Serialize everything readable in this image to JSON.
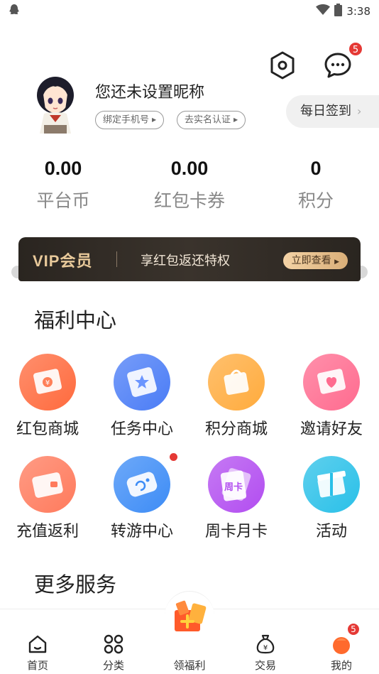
{
  "status_bar": {
    "time": "3:38"
  },
  "header": {
    "message_badge": "5"
  },
  "profile": {
    "nickname": "您还未设置昵称",
    "bind_phone": "绑定手机号",
    "real_name": "去实名认证",
    "checkin": "每日签到"
  },
  "stats": [
    {
      "value": "0.00",
      "label": "平台币"
    },
    {
      "value": "0.00",
      "label": "红包卡券"
    },
    {
      "value": "0",
      "label": "积分"
    }
  ],
  "vip": {
    "title": "VIP会员",
    "desc": "享红包返还特权",
    "button": "立即查看"
  },
  "welfare": {
    "title": "福利中心",
    "items": [
      {
        "label": "红包商城",
        "icon": "red-packet-icon",
        "color": "#ff6a3d"
      },
      {
        "label": "任务中心",
        "icon": "task-star-icon",
        "color": "#4a7cf6"
      },
      {
        "label": "积分商城",
        "icon": "shopping-bag-icon",
        "color": "#ffab3d"
      },
      {
        "label": "邀请好友",
        "icon": "heart-envelope-icon",
        "color": "#ff6b8f"
      },
      {
        "label": "充值返利",
        "icon": "wallet-icon",
        "color": "#ff7a5c"
      },
      {
        "label": "转游中心",
        "icon": "gamepad-icon",
        "color": "#3d8cf6"
      },
      {
        "label": "周卡月卡",
        "icon": "week-card-icon",
        "color": "#b24df0"
      },
      {
        "label": "活动",
        "icon": "gift-box-icon",
        "color": "#29c0e8"
      }
    ]
  },
  "more": {
    "title": "更多服务"
  },
  "tabbar": {
    "items": [
      {
        "label": "首页",
        "icon": "home-icon"
      },
      {
        "label": "分类",
        "icon": "grid-icon"
      },
      {
        "label": "领福利",
        "icon": "gift-icon"
      },
      {
        "label": "交易",
        "icon": "money-bag-icon"
      },
      {
        "label": "我的",
        "icon": "profile-icon"
      }
    ],
    "profile_badge": "5"
  }
}
